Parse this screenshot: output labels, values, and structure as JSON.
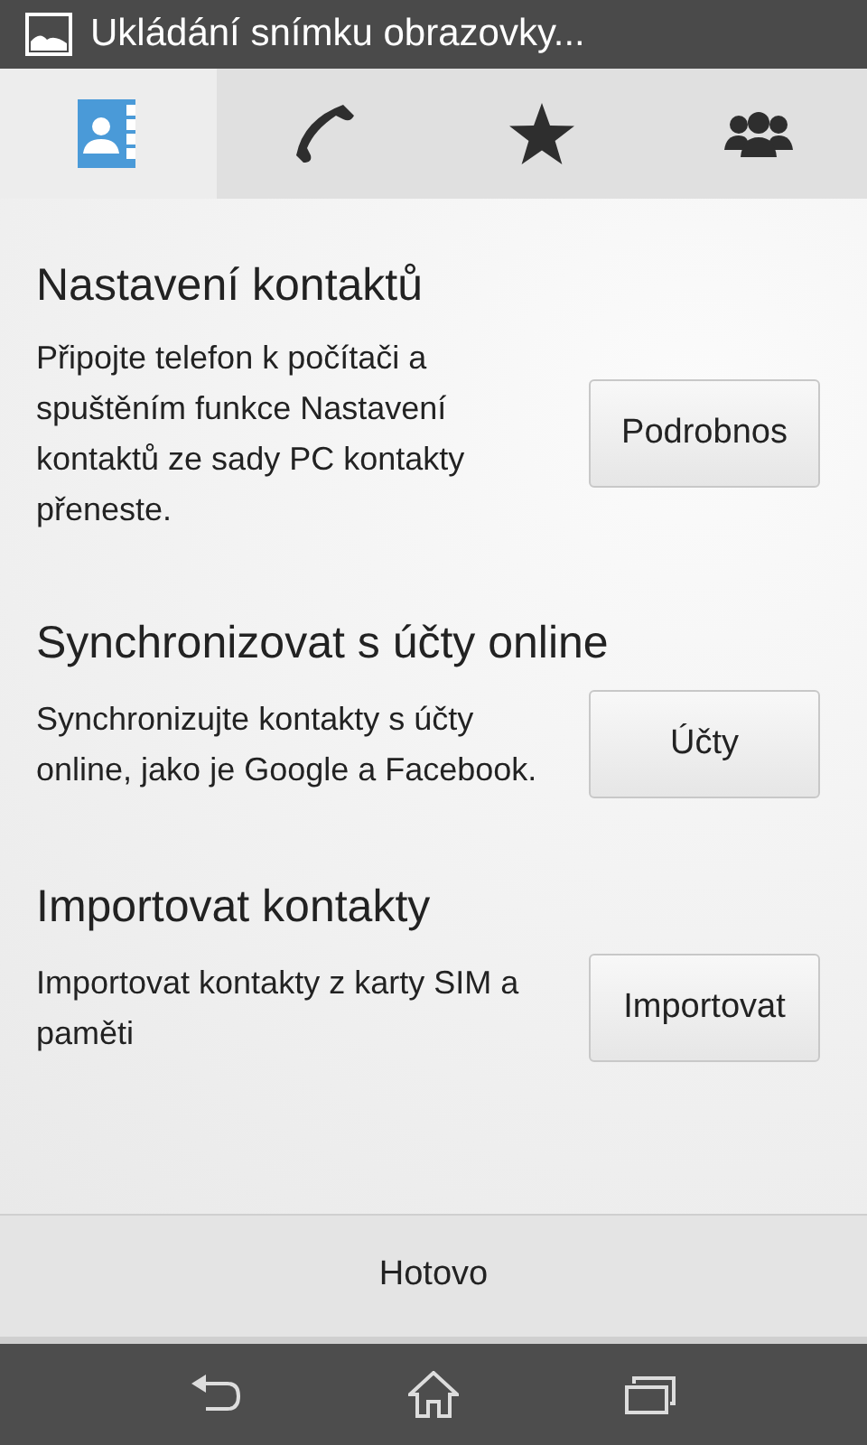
{
  "status_bar": {
    "notification": "Ukládání snímku obrazovky..."
  },
  "tabs": [
    {
      "kind": "contacts",
      "selected": true
    },
    {
      "kind": "phone",
      "selected": false
    },
    {
      "kind": "favorites",
      "selected": false
    },
    {
      "kind": "groups",
      "selected": false
    }
  ],
  "sections": [
    {
      "title": "Nastavení kontaktů",
      "description": "Připojte telefon k počítači a spuštěním funkce Nastavení kontaktů ze sady PC kontakty přeneste.",
      "button": "Podrobnos"
    },
    {
      "title": "Synchronizovat s účty online",
      "description": "Synchronizujte kontakty s účty online, jako je Google a Facebook.",
      "button": "Účty"
    },
    {
      "title": "Importovat kontakty",
      "description": "Importovat kontakty z karty SIM a paměti",
      "button": "Importovat"
    }
  ],
  "done_button": "Hotovo",
  "nav_bar": [
    {
      "kind": "back"
    },
    {
      "kind": "home"
    },
    {
      "kind": "recents"
    }
  ]
}
